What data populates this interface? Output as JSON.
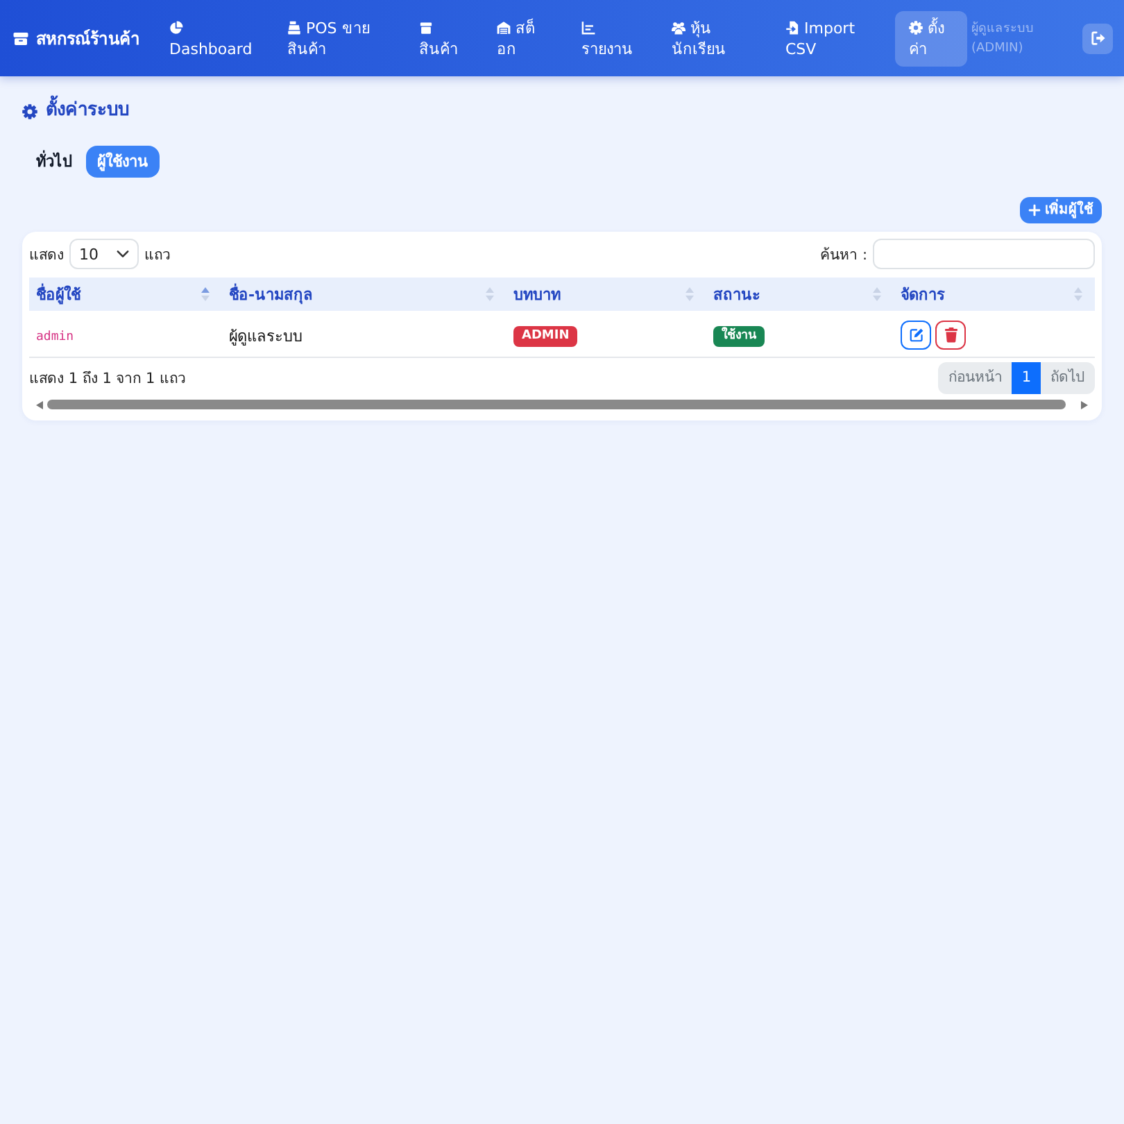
{
  "navbar": {
    "brand": "สหกรณ์ร้านค้า",
    "items": [
      {
        "label": "Dashboard",
        "selected": false
      },
      {
        "label": "POS ขายสินค้า",
        "selected": false
      },
      {
        "label": "สินค้า",
        "selected": false
      },
      {
        "label": "สต็อก",
        "selected": false
      },
      {
        "label": "รายงาน",
        "selected": false
      },
      {
        "label": "หุ้นนักเรียน",
        "selected": false
      },
      {
        "label": "Import CSV",
        "selected": false
      },
      {
        "label": "ตั้งค่า",
        "selected": true
      }
    ],
    "user": "ผู้ดูแลระบบ (ADMIN)"
  },
  "page": {
    "title": "ตั้งค่าระบบ",
    "tabs": [
      {
        "label": "ทั่วไป",
        "selected": false
      },
      {
        "label": "ผู้ใช้งาน",
        "selected": true
      }
    ],
    "add_button": "เพิ่มผู้ใช้"
  },
  "table": {
    "length_prefix": "แสดง",
    "page_length": "10",
    "length_suffix": "แถว",
    "search_label": "ค้นหา :",
    "columns": [
      {
        "label": "ชื่อผู้ใช้",
        "sorted": true
      },
      {
        "label": "ชื่อ-นามสกุล",
        "sorted": false
      },
      {
        "label": "บทบาท",
        "sorted": false
      },
      {
        "label": "สถานะ",
        "sorted": false
      },
      {
        "label": "จัดการ",
        "sorted": false
      }
    ],
    "rows": [
      {
        "username": "admin",
        "full_name": "ผู้ดูแลระบบ",
        "role": "ADMIN",
        "status": "ใช้งาน",
        "active": true
      }
    ],
    "info": "แสดง 1 ถึง 1 จาก 1 แถว",
    "pagination": [
      {
        "label": "ก่อนหน้า",
        "selected": false,
        "disabled": true
      },
      {
        "label": "1",
        "selected": true,
        "disabled": false
      },
      {
        "label": "ถัดไป",
        "selected": false,
        "disabled": true
      }
    ]
  }
}
